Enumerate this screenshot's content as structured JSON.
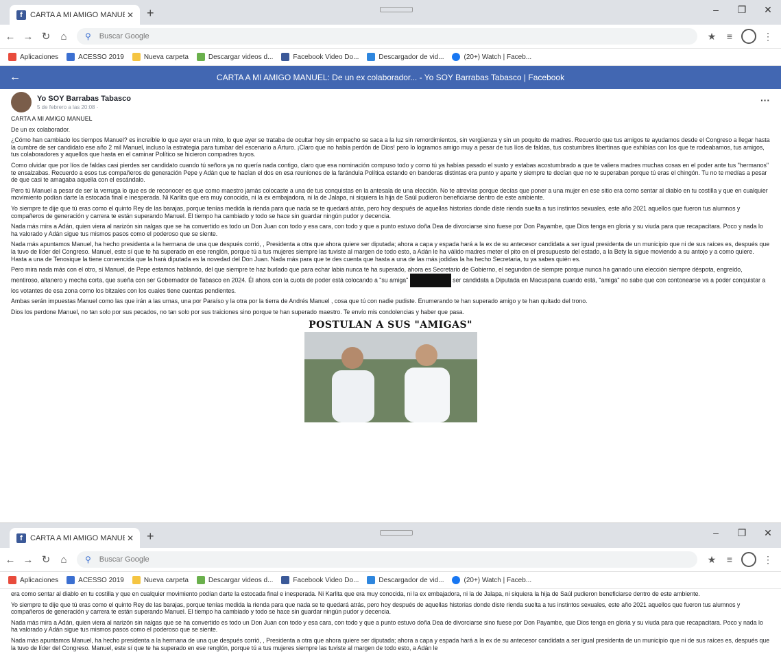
{
  "browser": {
    "tab_title": "CARTA A MI AMIGO MANUEL: D",
    "new_tab": "+",
    "omnibox_placeholder": "Buscar Google",
    "bookmarks": [
      {
        "label": "Aplicaciones",
        "color": "#e84b3c"
      },
      {
        "label": "ACESSO 2019",
        "color": "#3b6fd1"
      },
      {
        "label": "Nueva carpeta",
        "color": "#f5c542"
      },
      {
        "label": "Descargar videos d...",
        "color": "#6ab04c"
      },
      {
        "label": "Facebook Video Do...",
        "color": "#3b5998"
      },
      {
        "label": "Descargador de vid...",
        "color": "#2e86de"
      },
      {
        "label": "(20+) Watch | Faceb...",
        "color": "#1877f2"
      }
    ]
  },
  "fb_header": {
    "title": "CARTA A MI AMIGO MANUEL: De un ex colaborador... - Yo SOY Barrabas Tabasco | Facebook"
  },
  "post": {
    "author": "Yo SOY Barrabas Tabasco",
    "date": "5 de febrero a las 20:08 · ",
    "more": "···",
    "paragraphs": [
      "CARTA A MI AMIGO MANUEL",
      "De un ex colaborador.",
      "¿Cómo han cambiado los tiempos Manuel? es increíble lo que ayer era un mito, lo que ayer se trataba de ocultar hoy sin empacho se saca a la luz sin remordimientos, sin vergüenza y sin un poquito de madres. Recuerdo que tus amigos te ayudamos desde el Congreso a llegar hasta la cumbre de ser candidato ese año 2 mil Manuel, incluso la estrategia para tumbar del escenario a Arturo. ¡Claro que no había perdón de Dios! pero lo logramos amigo muy a pesar de tus líos de faldas, tus costumbres libertinas que exhibías con los que te rodeabamos, tus amigos, tus colaboradores y aquellos que hasta en el caminar Político se hicieron compadres tuyos.",
      "Como olvidar que por líos de faldas casi pierdes ser candidato cuando tú señora ya no quería nada contigo, claro que esa nominación compuso todo y como tú ya habías pasado el susto y estabas acostumbrado a que te valiera madres muchas cosas en el poder ante tus \"hermanos\" te ensalzabas. Recuerdo a esos tus compañeros de generación Pepe y Adán que te hacían el dos en esa reuniones de la farándula Política estando en banderas distintas era punto y aparte y siempre te decían que no te superaban porque tú eras el chingón. Tu no te medías a pesar de que casi te amagaba aquella con el escándalo.",
      "Pero tú Manuel a pesar de ser la verruga lo que es de reconocer es que como maestro jamás colocaste a una de tus conquistas en la antesala de una elección. No te atrevías porque decías que poner a una mujer en ese sitio era como sentar al diablo en tu costilla y que en cualquier movimiento podían darte la estocada final e inesperada. Ni Karlita que era muy conocida, ni la ex embajadora, ni la de Jalapa, ni siquiera la hija de Saúl pudieron beneficiarse dentro de este ambiente.",
      "Yo siempre te dije que tú eras como el quinto Rey de las barajas, porque tenías medida la rienda para que nada se te quedará atrás, pero hoy después de aquellas historias donde diste rienda suelta a tus instintos sexuales, este año 2021 aquellos que fueron tus alumnos y compañeros de generación y carrera te están superando Manuel. El tiempo ha cambiado y todo se hace sin guardar ningún pudor y decencia.",
      "Nada más mira a Adán, quien viera al narizón sin nalgas que se ha convertido es todo un Don Juan con todo y esa cara, con todo y que a punto estuvo doña Dea de divorciarse sino fuese por Don Payambe, que Dios tenga en gloria y su viuda para que recapacitara. Poco y nada lo ha valorado y Adán sigue tus mismos pasos como el poderoso que se siente.",
      "Nada más apuntamos Manuel, ha hecho presidenta a la hermana de una que después corrió, , Presidenta a otra que ahora quiere ser diputada; ahora a capa y espada hará a la ex de su antecesor candidata a ser igual presidenta de un municipio que ni de sus raíces es, después que la tuvo de líder del Congreso. Manuel, este sí que te ha superado en ese renglón, porque tú a tus mujeres siempre las tuviste al margen de todo esto, a Adán le ha válido madres meter el pito en el presupuesto del estado, a la Bety la sigue moviendo a su antojo y a como quiere. Hasta a una de Tenosique la tiene convencida que la hará diputada es la novedad del Don Juan. Nada más para que te des cuenta que hasta a una de las más jodidas la ha hecho Secretaria, tu ya sabes quién es."
    ],
    "para_pepe_a": "Pero mira nada más con el otro, sí Manuel, de Pepe estamos hablando, del que siempre te haz burlado que para echar labia nunca te ha superado, ahora es Secretario de Gobierno, el segundon de siempre porque nunca ha ganado una elección siempre déspota, engreído, mentiroso, altanero y mecha corta, que sueña con ser Gobernador de Tabasco en 2024. Él ahora con la cuota de poder está colocando a \"su amiga\" ",
    "para_pepe_b": " ser candidata a Diputada en Macuspana cuando está, \"amiga\" no sabe que con contonearse va a poder conquistar a los votantes de esa zona como los bitzales con los cuales tiene cuentas pendientes.",
    "para_end": [
      "Ambas serán impuestas Manuel como las que irán a las urnas, una por Paraíso y la otra por la tierra de Andrés Manuel , cosa que tú con nadie pudiste. Enumerando te han superado amigo y te han quitado del trono.",
      "Dios los perdone Manuel, no tan solo por sus pecados, no tan solo por sus traiciones sino porque te han superado maestro. Te envío mis condolencias y haber que pasa."
    ],
    "image_title": "POSTULAN A SUS \"AMIGAS\""
  },
  "second_view": {
    "cut_top": "era como sentar al diablo en tu costilla y que en cualquier movimiento podían darte la estocada final e inesperada. Ni Karlita que era muy conocida, ni la ex embajadora, ni la de Jalapa, ni siquiera la hija de Saúl pudieron beneficiarse dentro de este ambiente.",
    "p1": "Yo siempre te dije que tú eras como el quinto Rey de las barajas, porque tenías medida la rienda para que nada se te quedará atrás, pero hoy después de aquellas historias donde diste rienda suelta a tus instintos sexuales, este año 2021 aquellos que fueron tus alumnos y compañeros de generación y carrera te están superando Manuel. El tiempo ha cambiado y todo se hace sin guardar ningún pudor y decencia.",
    "p2": "Nada más mira a Adán, quien viera al narizón sin nalgas que se ha convertido es todo un Don Juan con todo y esa cara, con todo y que a punto estuvo doña Dea de divorciarse sino fuese por Don Payambe, que Dios tenga en gloria y su viuda para que recapacitara. Poco y nada lo ha valorado y Adán sigue tus mismos pasos como el poderoso que se siente.",
    "p3": "Nada más apuntamos Manuel, ha hecho presidenta a la hermana de una que después corrió, , Presidenta a otra que ahora quiere ser diputada; ahora a capa y espada hará a la ex de su antecesor candidata a ser igual presidenta de un municipio que ni de sus raíces es, después que la tuvo de líder del Congreso. Manuel, este sí que te ha superado en ese renglón, porque tú a tus mujeres siempre las tuviste al margen de todo esto, a Adán le"
  }
}
